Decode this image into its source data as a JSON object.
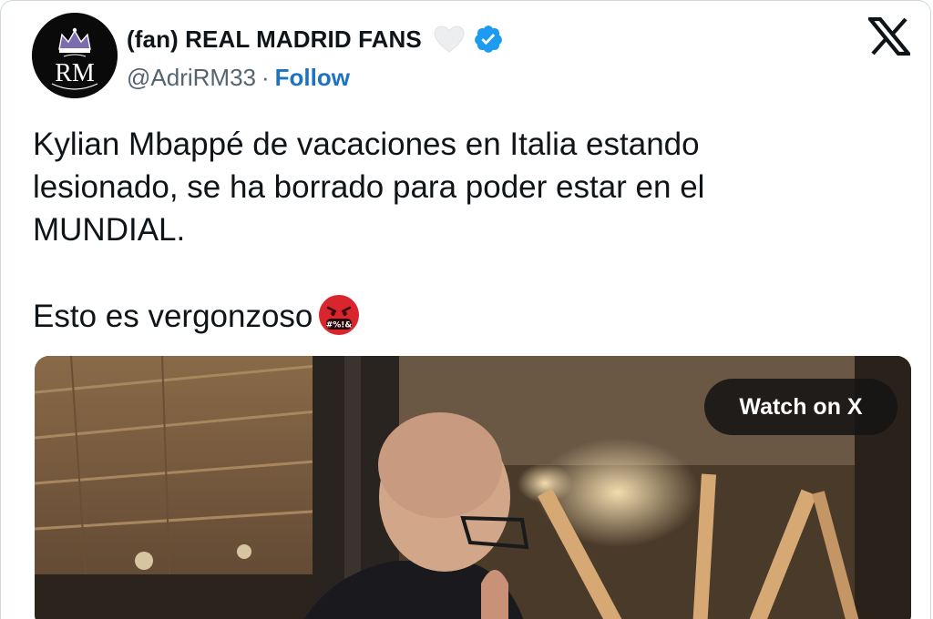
{
  "tweet": {
    "author": {
      "display_name": "(fan) REAL MADRID FANS",
      "handle": "@AdriRM33",
      "separator": "·",
      "follow_label": "Follow",
      "avatar_text": "RM",
      "avatar_icon": "crown-icon",
      "heart_icon": "white-heart-icon",
      "verified_icon": "verified-badge-icon",
      "verified_color": "#1d9bf0"
    },
    "platform_logo": "x-logo-icon",
    "text_lines": [
      "Kylian Mbappé de vacaciones en Italia estando",
      "lesionado, se ha borrado para poder estar en el",
      "MUNDIAL."
    ],
    "text_second_paragraph": "Esto es vergonzoso",
    "emoji": "face-with-symbols-on-mouth",
    "emoji_symbols": "#%!&",
    "media": {
      "type": "video",
      "watch_label": "Watch on X"
    },
    "colors": {
      "text": "#0f1419",
      "secondary": "#536471",
      "link": "#1d72c2",
      "border": "#cfd9de"
    }
  }
}
